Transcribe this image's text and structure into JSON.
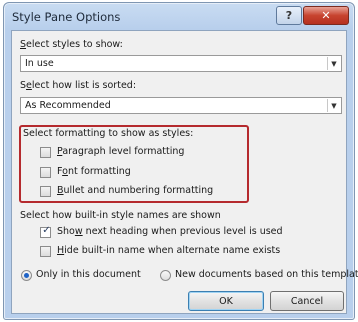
{
  "window": {
    "title": "Style Pane Options",
    "help_glyph": "?",
    "close_glyph": "✕"
  },
  "show_styles": {
    "label_key": "S",
    "label_rest": "elect styles to show:",
    "value": "In use"
  },
  "sorted": {
    "label_pre": "S",
    "label_key": "e",
    "label_rest": "lect how list is sorted:",
    "value": "As Recommended"
  },
  "formatting": {
    "heading": "Select formatting to show as styles:",
    "options": [
      {
        "key": "P",
        "rest": "aragraph level formatting",
        "checked": false
      },
      {
        "pre": "F",
        "key": "o",
        "rest": "nt formatting",
        "checked": false
      },
      {
        "key": "B",
        "rest": "ullet and numbering formatting",
        "checked": false
      }
    ]
  },
  "builtin": {
    "heading": "Select how built-in style names are shown",
    "options": [
      {
        "pre": "Sho",
        "key": "w",
        "rest": " next heading when previous level is used",
        "checked": true
      },
      {
        "key": "H",
        "rest": "ide built-in name when alternate name exists",
        "checked": false
      }
    ]
  },
  "scope": {
    "options": [
      {
        "label": "Only in this document",
        "selected": true
      },
      {
        "label": "New documents based on this template",
        "selected": false
      }
    ]
  },
  "buttons": {
    "ok": "OK",
    "cancel": "Cancel"
  },
  "dropdown_arrow": "▼",
  "check_mark": "✓",
  "colors": {
    "highlight_border": "#b52a2e",
    "radio_selected": "#1f63c7",
    "close_button": "#c7432f"
  }
}
